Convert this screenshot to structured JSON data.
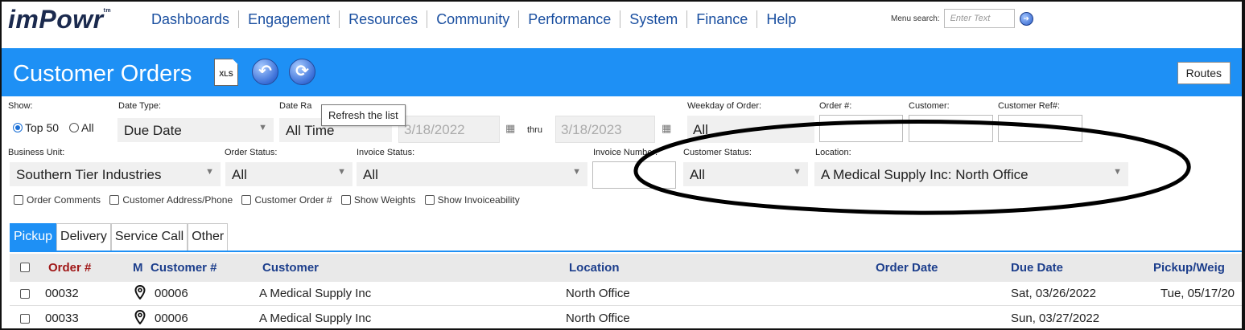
{
  "app": {
    "logo": "imPowr",
    "logo_tm": "tm"
  },
  "menu": {
    "items": [
      "Dashboards",
      "Engagement",
      "Resources",
      "Community",
      "Performance",
      "System",
      "Finance",
      "Help"
    ],
    "search_label": "Menu search:",
    "search_placeholder": "Enter Text"
  },
  "titlebar": {
    "title": "Customer Orders",
    "xls_label": "XLS",
    "routes_label": "Routes"
  },
  "tooltip": "Refresh the list",
  "filters": {
    "show_label": "Show:",
    "show_top50": "Top 50",
    "show_all": "All",
    "date_type_label": "Date Type:",
    "date_type_value": "Due Date",
    "date_range_label": "Date Ra",
    "date_range_value": "All Time",
    "date_from": "3/18/2022",
    "thru_label": "thru",
    "date_to": "3/18/2023",
    "weekday_label": "Weekday of Order:",
    "weekday_value": "All",
    "order_num_label": "Order #:",
    "customer_label": "Customer:",
    "customer_ref_label": "Customer Ref#:",
    "business_unit_label": "Business Unit:",
    "business_unit_value": "Southern Tier Industries",
    "order_status_label": "Order Status:",
    "order_status_value": "All",
    "invoice_status_label": "Invoice Status:",
    "invoice_status_value": "All",
    "invoice_number_label": "Invoice Number:",
    "customer_status_label": "Customer Status:",
    "customer_status_value": "All",
    "location_label": "Location:",
    "location_value": "A Medical Supply Inc: North Office"
  },
  "checkboxes": [
    "Order Comments",
    "Customer Address/Phone",
    "Customer Order #",
    "Show Weights",
    "Show Invoiceability"
  ],
  "tabs": [
    "Pickup",
    "Delivery",
    "Service Call",
    "Other"
  ],
  "table": {
    "headers": {
      "order": "Order #",
      "m": "M",
      "customer_num": "Customer #",
      "customer": "Customer",
      "location": "Location",
      "order_date": "Order Date",
      "due_date": "Due Date",
      "pickup": "Pickup/Weig"
    },
    "rows": [
      {
        "order": "00032",
        "customer_num": "00006",
        "customer": "A Medical Supply Inc",
        "location": "North Office",
        "order_date": "",
        "due_date": "Sat, 03/26/2022",
        "pickup": "Tue, 05/17/20"
      },
      {
        "order": "00033",
        "customer_num": "00006",
        "customer": "A Medical Supply Inc",
        "location": "North Office",
        "order_date": "",
        "due_date": "Sun, 03/27/2022",
        "pickup": ""
      }
    ]
  },
  "colors": {
    "accent": "#1e90f5",
    "header_text": "#1c3e8c",
    "order_header": "#a01818"
  }
}
